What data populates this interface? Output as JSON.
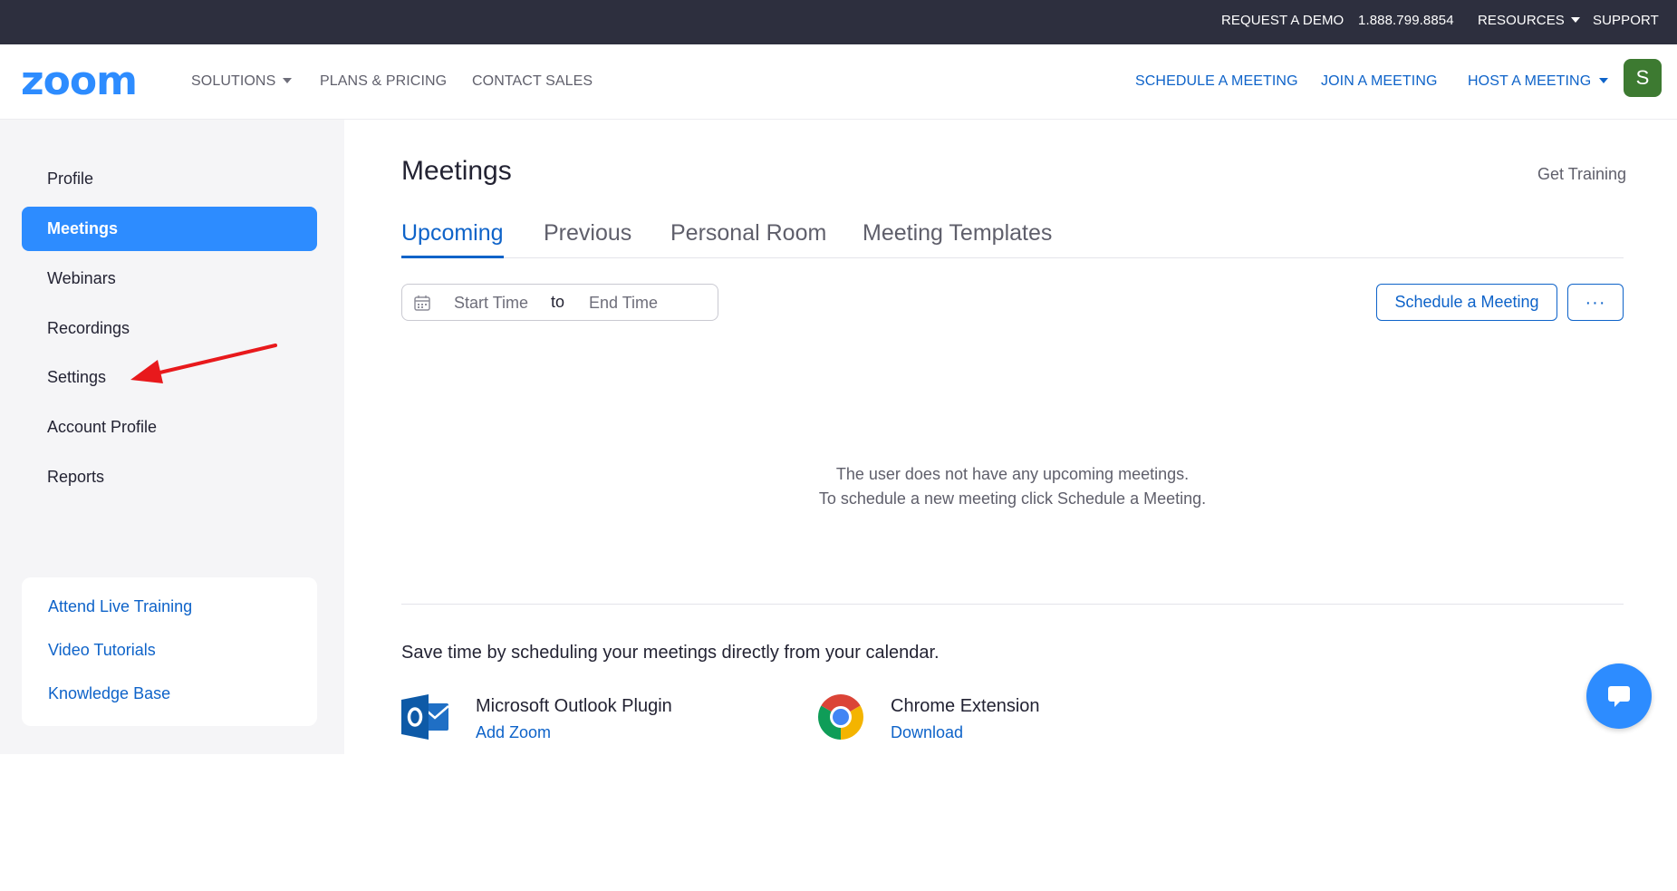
{
  "topbar": {
    "request_demo": "REQUEST A DEMO",
    "phone": "1.888.799.8854",
    "resources": "RESOURCES",
    "support": "SUPPORT"
  },
  "header": {
    "logo": "zoom",
    "solutions": "SOLUTIONS",
    "plans_pricing": "PLANS & PRICING",
    "contact_sales": "CONTACT SALES",
    "schedule_meeting": "SCHEDULE A MEETING",
    "join_meeting": "JOIN A MEETING",
    "host_meeting": "HOST A MEETING",
    "avatar_initial": "S"
  },
  "sidebar": {
    "items": [
      {
        "label": "Profile",
        "active": false
      },
      {
        "label": "Meetings",
        "active": true
      },
      {
        "label": "Webinars",
        "active": false
      },
      {
        "label": "Recordings",
        "active": false
      },
      {
        "label": "Settings",
        "active": false
      },
      {
        "label": "Account Profile",
        "active": false
      },
      {
        "label": "Reports",
        "active": false
      }
    ],
    "links": [
      "Attend Live Training",
      "Video Tutorials",
      "Knowledge Base"
    ]
  },
  "main": {
    "title": "Meetings",
    "get_training": "Get Training",
    "tabs": [
      {
        "label": "Upcoming",
        "active": true
      },
      {
        "label": "Previous",
        "active": false
      },
      {
        "label": "Personal Room",
        "active": false
      },
      {
        "label": "Meeting Templates",
        "active": false
      }
    ],
    "date_range": {
      "start_placeholder": "Start Time",
      "separator": "to",
      "end_placeholder": "End Time"
    },
    "schedule_button": "Schedule a Meeting",
    "more_button": "···",
    "empty_line1": "The user does not have any upcoming meetings.",
    "empty_line2": "To schedule a new meeting click Schedule a Meeting.",
    "calendar_promo": "Save time by scheduling your meetings directly from your calendar.",
    "plugins": [
      {
        "name": "Microsoft Outlook Plugin",
        "link": "Add Zoom",
        "icon": "outlook-icon"
      },
      {
        "name": "Chrome Extension",
        "link": "Download",
        "icon": "chrome-icon"
      }
    ]
  },
  "colors": {
    "topbar_bg": "#2d2f3e",
    "brand_blue": "#0e63c9",
    "active_blue": "#2d8cff",
    "sidebar_bg": "#f5f5f7",
    "avatar_green": "#3d7a31",
    "annotation_red": "#e8191c"
  },
  "annotation": {
    "type": "arrow",
    "points_to": "Settings"
  }
}
